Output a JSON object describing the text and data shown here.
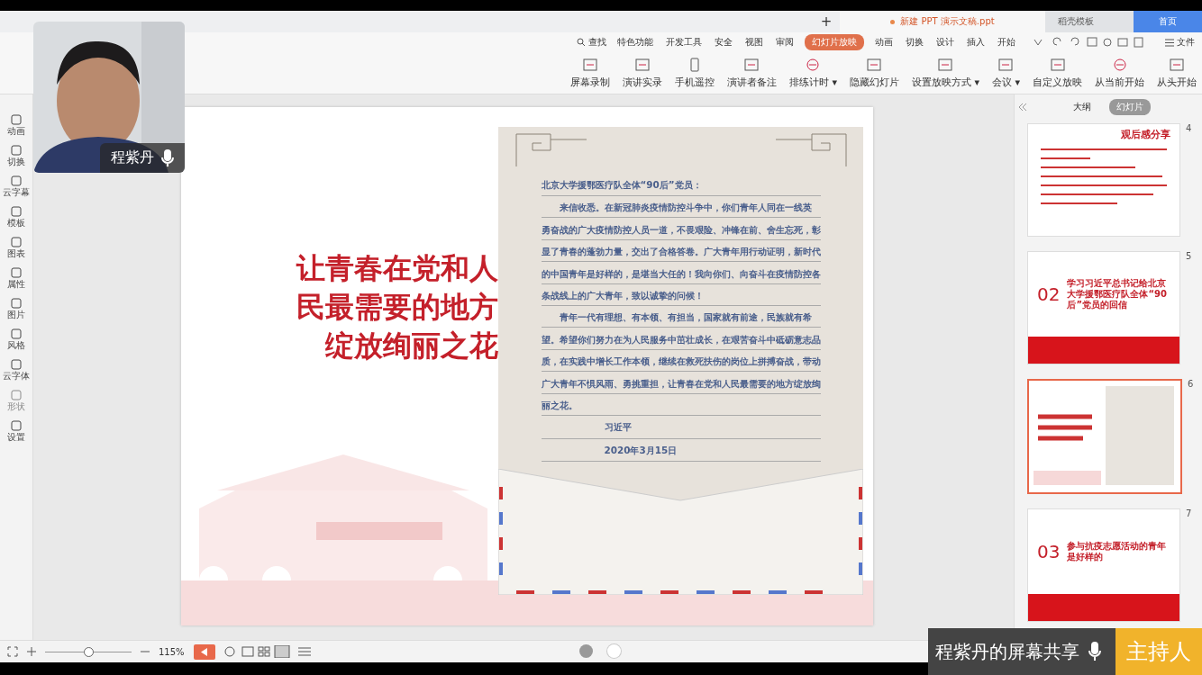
{
  "title_bar": {
    "tabs": [
      {
        "label": "新建 PPT 演示文稿.ppt",
        "selected": true,
        "kind": "doc"
      },
      {
        "label": "稻壳模板",
        "selected": false,
        "kind": "docer"
      },
      {
        "label": "首页",
        "selected": false,
        "kind": "home"
      }
    ],
    "new_tab": "+"
  },
  "menu": {
    "search": "查找",
    "tabs": [
      {
        "label": "特色功能",
        "selected": false
      },
      {
        "label": "开发工具",
        "selected": false
      },
      {
        "label": "安全",
        "selected": false
      },
      {
        "label": "视图",
        "selected": false
      },
      {
        "label": "审阅",
        "selected": false
      },
      {
        "label": "幻灯片放映",
        "selected": true
      },
      {
        "label": "动画",
        "selected": false
      },
      {
        "label": "切换",
        "selected": false
      },
      {
        "label": "设计",
        "selected": false
      },
      {
        "label": "插入",
        "selected": false
      },
      {
        "label": "开始",
        "selected": false
      }
    ],
    "file": "文件"
  },
  "ribbon": [
    {
      "label": "屏幕录制"
    },
    {
      "label": "演讲实录"
    },
    {
      "label": "手机遥控"
    },
    {
      "label": "演讲者备注"
    },
    {
      "label": "排练计时 ▾"
    },
    {
      "label": "隐藏幻灯片"
    },
    {
      "label": "设置放映方式 ▾"
    },
    {
      "label": "会议 ▾"
    },
    {
      "label": "自定义放映"
    },
    {
      "label": "从当前开始"
    },
    {
      "label": "从头开始"
    }
  ],
  "sidebar": [
    {
      "label": "动画",
      "disabled": false
    },
    {
      "label": "切换",
      "disabled": false
    },
    {
      "label": "云字幕",
      "disabled": false
    },
    {
      "label": "模板",
      "disabled": false
    },
    {
      "label": "图表",
      "disabled": false
    },
    {
      "label": "属性",
      "disabled": false
    },
    {
      "label": "图片",
      "disabled": false
    },
    {
      "label": "风格",
      "disabled": false
    },
    {
      "label": "云字体",
      "disabled": false
    },
    {
      "label": "形状",
      "disabled": true
    },
    {
      "label": "设置",
      "disabled": false
    }
  ],
  "slide": {
    "title": [
      "让青春在党和人",
      "民最需要的地方",
      "绽放绚丽之花"
    ],
    "letter": {
      "salutation": "北京大学援鄂医疗队全体“90后”党员：",
      "paragraphs": [
        "来信收悉。在新冠肺炎疫情防控斗争中，你们青年人同在一线英勇奋战的广大疫情防控人员一道，不畏艰险、冲锋在前、舍生忘死，彰显了青春的蓬勃力量，交出了合格答卷。广大青年用行动证明，新时代的中国青年是好样的，是堪当大任的！我向你们、向奋斗在疫情防控各条战线上的广大青年，致以诚挚的问候！",
        "青年一代有理想、有本领、有担当，国家就有前途，民族就有希望。希望你们努力在为人民服务中茁壮成长，在艰苦奋斗中砥砺意志品质，在实践中增长工作本领，继续在救死扶伤的岗位上拼搏奋战，带动广大青年不惧风雨、勇挑重担，让青春在党和人民最需要的地方绽放绚丽之花。"
      ],
      "signature": "习近平",
      "date": "2020年3月15日"
    }
  },
  "panel": {
    "tabs": [
      {
        "label": "大纲",
        "selected": false
      },
      {
        "label": "幻灯片",
        "selected": true
      }
    ],
    "thumbnails": [
      {
        "number": "4",
        "kind": "text",
        "selected": false,
        "title": "观后感分享"
      },
      {
        "number": "5",
        "kind": "section",
        "selected": false,
        "index": "02",
        "text": "学习习近平总书记给北京大学援鄂医疗队全体“90后”党员的回信"
      },
      {
        "number": "6",
        "kind": "letter",
        "selected": true
      },
      {
        "number": "7",
        "kind": "section",
        "selected": false,
        "index": "03",
        "text": "参与抗疫志愿活动的青年是好样的"
      }
    ]
  },
  "status_bar": {
    "zoom": "115%",
    "zoom_slider": {
      "level": 0.5
    }
  },
  "webcam": {
    "name": "程紫丹"
  },
  "share_bar": {
    "text": "程紫丹的屏幕共享",
    "host": "主持人"
  }
}
